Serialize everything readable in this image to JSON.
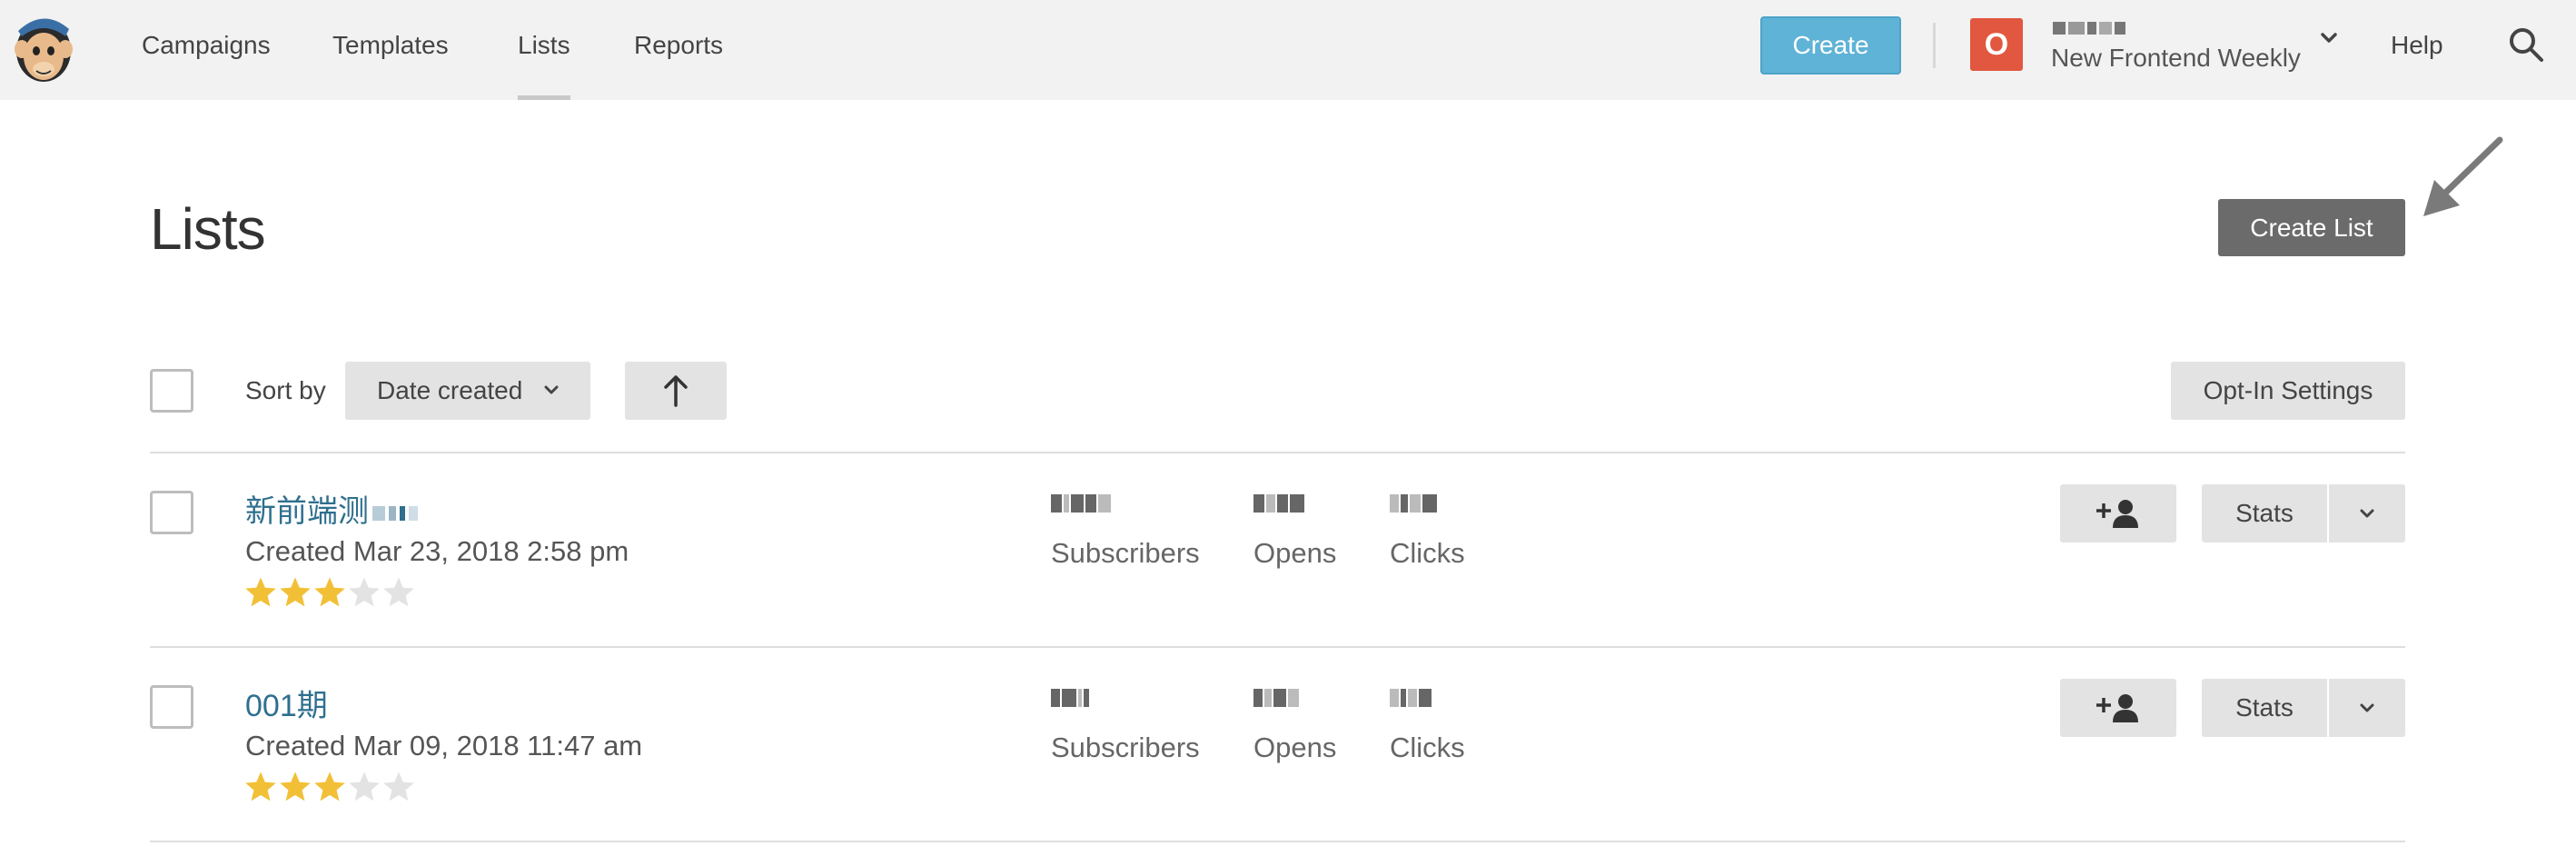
{
  "nav": {
    "logo": "mailchimp-freddie-logo",
    "items": [
      {
        "label": "Campaigns",
        "active": false
      },
      {
        "label": "Templates",
        "active": false
      },
      {
        "label": "Lists",
        "active": true
      },
      {
        "label": "Reports",
        "active": false
      }
    ],
    "create_label": "Create",
    "account": {
      "avatar_letter": "O",
      "avatar_color": "#e1573f",
      "subtitle": "New Frontend Weekly"
    },
    "help_label": "Help",
    "search_icon": "search-icon"
  },
  "page": {
    "title": "Lists",
    "create_list_label": "Create List"
  },
  "toolbar": {
    "sort_by_label": "Sort by",
    "sort_value": "Date created",
    "sort_direction_icon": "arrow-up-icon",
    "optin_label": "Opt-In Settings"
  },
  "lists": [
    {
      "name": "新前端测",
      "created": "Created Mar 23, 2018 2:58 pm",
      "rating": 3,
      "labels": {
        "subscribers": "Subscribers",
        "opens": "Opens",
        "clicks": "Clicks"
      },
      "stats_label": "Stats"
    },
    {
      "name": "001期",
      "created": "Created Mar 09, 2018 11:47 am",
      "rating": 3,
      "labels": {
        "subscribers": "Subscribers",
        "opens": "Opens",
        "clicks": "Clicks"
      },
      "stats_label": "Stats"
    }
  ],
  "colors": {
    "accent": "#5fb3d6",
    "link": "#2f6f8f",
    "star_filled": "#f2c037",
    "star_empty": "#e3e3e3",
    "create_list_bg": "#6b6b6b"
  }
}
